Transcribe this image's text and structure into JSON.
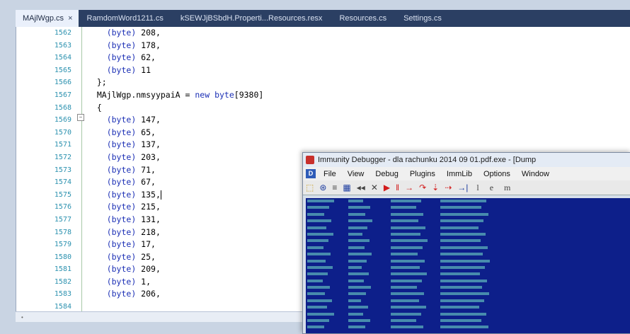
{
  "tabs": [
    {
      "label": "MAjlWgp.cs",
      "active": true,
      "close": "×"
    },
    {
      "label": "RamdomWord1211.cs",
      "active": false
    },
    {
      "label": "kSEWJjBSbdH.Properti...Resources.resx",
      "active": false
    },
    {
      "label": "Resources.cs",
      "active": false
    },
    {
      "label": "Settings.cs",
      "active": false
    }
  ],
  "editor": {
    "line_numbers": [
      "1562",
      "1563",
      "1564",
      "1565",
      "1566",
      "1567",
      "1568",
      "1569",
      "1570",
      "1571",
      "1572",
      "1573",
      "1574",
      "1575",
      "1576",
      "1577",
      "1578",
      "1579",
      "1580",
      "1581",
      "1582",
      "1583",
      "1584"
    ],
    "lines": [
      {
        "indent": "    ",
        "kw": "(byte)",
        "rest": " 208,"
      },
      {
        "indent": "    ",
        "kw": "(byte)",
        "rest": " 178,"
      },
      {
        "indent": "    ",
        "kw": "(byte)",
        "rest": " 62,"
      },
      {
        "indent": "    ",
        "kw": "(byte)",
        "rest": " 11"
      },
      {
        "indent": "  ",
        "kw": "",
        "rest": "};"
      },
      {
        "indent": "  ",
        "kw": "",
        "rest": "MAjlWgp.nmsyypaiA = new byte[9380]"
      },
      {
        "indent": "  ",
        "kw": "",
        "rest": "{"
      },
      {
        "indent": "    ",
        "kw": "(byte)",
        "rest": " 147,"
      },
      {
        "indent": "    ",
        "kw": "(byte)",
        "rest": " 65,"
      },
      {
        "indent": "    ",
        "kw": "(byte)",
        "rest": " 137,"
      },
      {
        "indent": "    ",
        "kw": "(byte)",
        "rest": " 203,"
      },
      {
        "indent": "    ",
        "kw": "(byte)",
        "rest": " 71,"
      },
      {
        "indent": "    ",
        "kw": "(byte)",
        "rest": " 67,"
      },
      {
        "indent": "    ",
        "kw": "(byte)",
        "rest": " 135,"
      },
      {
        "indent": "    ",
        "kw": "(byte)",
        "rest": " 215,"
      },
      {
        "indent": "    ",
        "kw": "(byte)",
        "rest": " 131,"
      },
      {
        "indent": "    ",
        "kw": "(byte)",
        "rest": " 218,"
      },
      {
        "indent": "    ",
        "kw": "(byte)",
        "rest": " 17,"
      },
      {
        "indent": "    ",
        "kw": "(byte)",
        "rest": " 25,"
      },
      {
        "indent": "    ",
        "kw": "(byte)",
        "rest": " 209,"
      },
      {
        "indent": "    ",
        "kw": "(byte)",
        "rest": " 1,"
      },
      {
        "indent": "    ",
        "kw": "(byte)",
        "rest": " 206,"
      },
      {
        "indent": "    ",
        "kw": "",
        "rest": ""
      }
    ],
    "fold_symbol": "−"
  },
  "debugger": {
    "title": "Immunity Debugger - dla rachunku 2014 09 01.pdf.exe - [Dump",
    "menu": [
      "File",
      "View",
      "Debug",
      "Plugins",
      "ImmLib",
      "Options",
      "Window"
    ],
    "menu_icon": "D",
    "toolbar": [
      "open-icon",
      "rewind-icon",
      "list-icon",
      "grid-icon",
      "step-back-icon",
      "close-x-icon",
      "play-icon",
      "pause-icon",
      "step-into-icon",
      "step-over-icon",
      "trace-into-icon",
      "trace-over-icon",
      "execute-till-return-icon"
    ],
    "toolbar_glyphs": [
      "⬚",
      "⊛",
      "≡",
      "▦",
      "◂◂",
      "✕",
      "▶",
      "‖",
      "→",
      "↷",
      "⇣",
      "⇢",
      "→|"
    ],
    "toolbar_trail": "l e m",
    "colors": {
      "pane": "#0d1f8a",
      "text": "#5bb0b8"
    }
  },
  "colors": {
    "tabbar": "#2b3f63",
    "frame": "#c9d4e3",
    "keyword": "#1b2fb5",
    "line_number": "#2b91af"
  }
}
